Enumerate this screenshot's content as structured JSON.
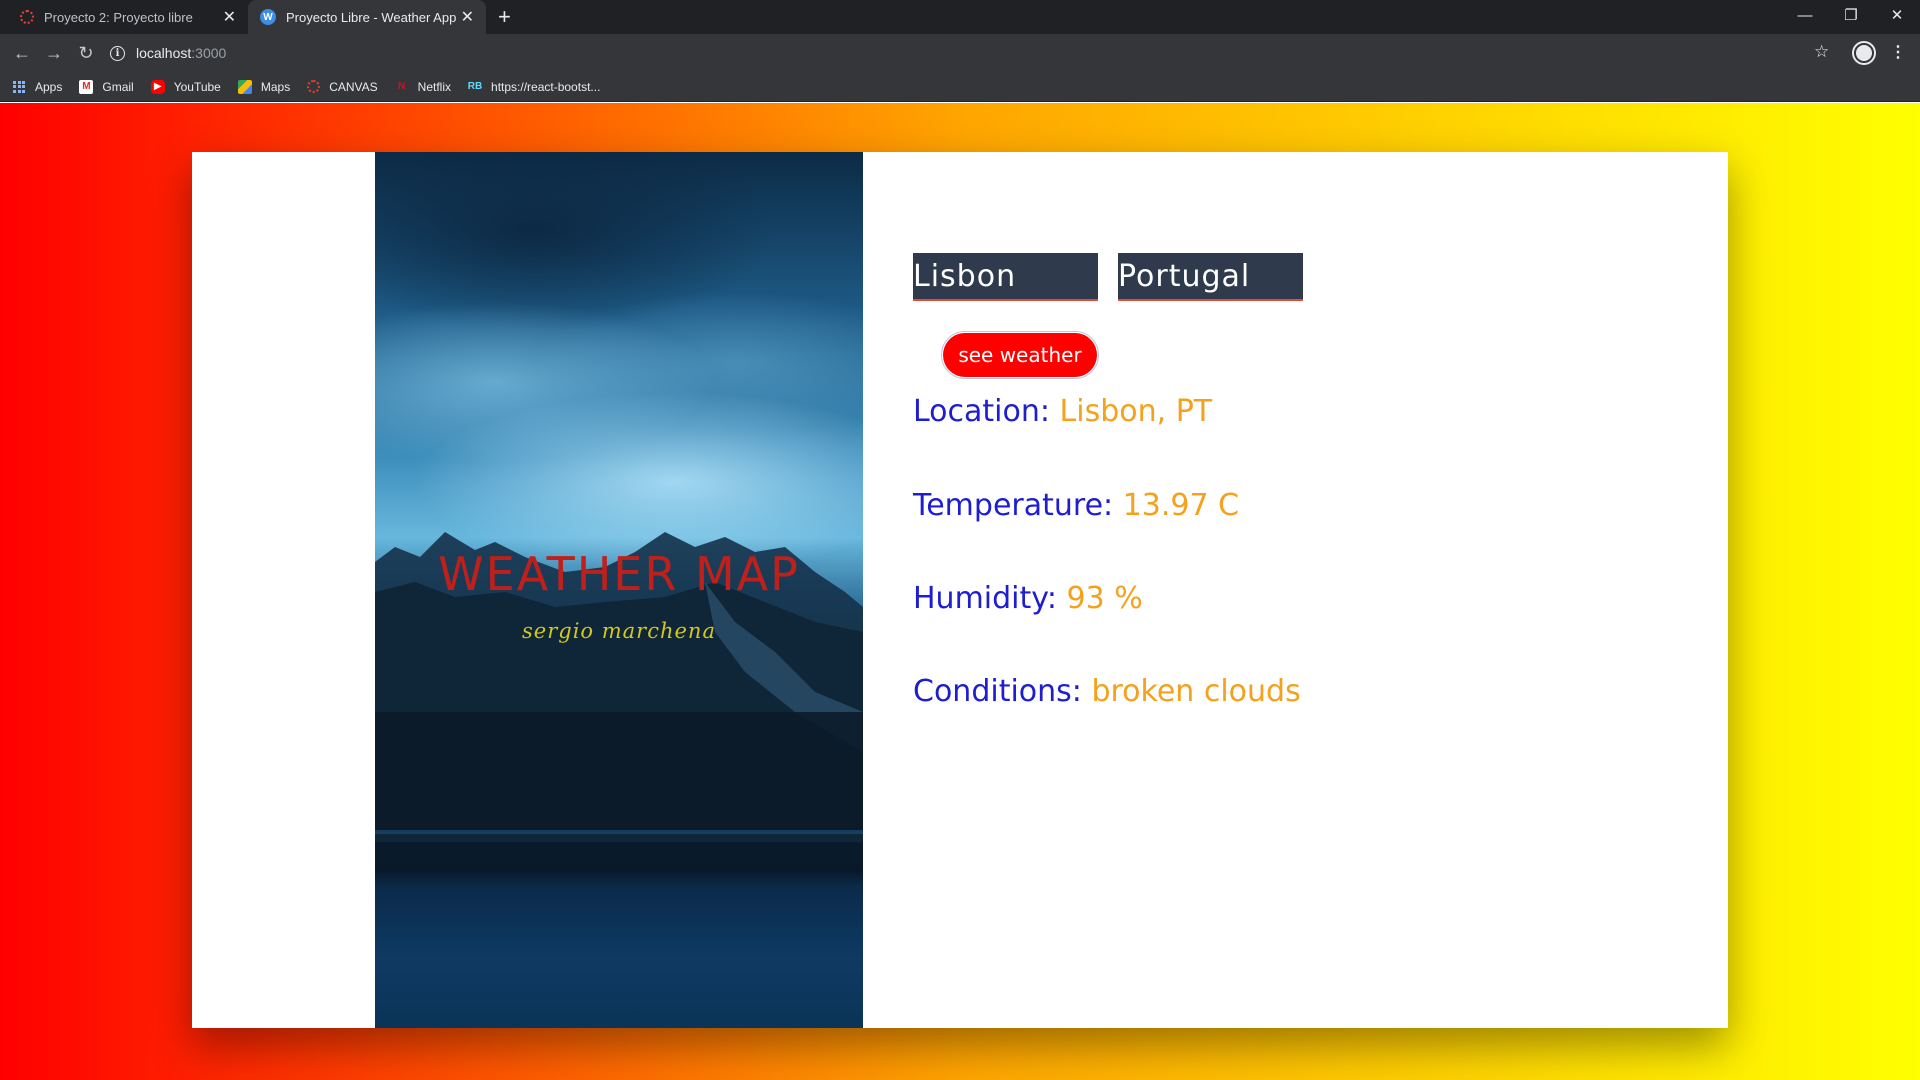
{
  "browser": {
    "tabs": [
      {
        "title": "Proyecto 2: Proyecto libre",
        "icon": "canvas-ring-icon",
        "active": false
      },
      {
        "title": "Proyecto Libre - Weather App",
        "icon": "weather-app-favicon-icon",
        "active": true
      }
    ],
    "address": {
      "host": "localhost",
      "port": ":3000"
    },
    "bookmarks": [
      {
        "label": "Apps",
        "icon": "apps-grid-icon"
      },
      {
        "label": "Gmail",
        "icon": "gmail-icon"
      },
      {
        "label": "YouTube",
        "icon": "youtube-icon"
      },
      {
        "label": "Maps",
        "icon": "maps-icon"
      },
      {
        "label": "CANVAS",
        "icon": "canvas-icon"
      },
      {
        "label": "Netflix",
        "icon": "netflix-icon"
      },
      {
        "label": "https://react-bootst...",
        "icon": "react-bootstrap-icon"
      }
    ]
  },
  "page": {
    "background_gradient": [
      "#ff0000",
      "#ffa500",
      "#ffff00"
    ],
    "hero": {
      "title": "WEATHER MAP",
      "subtitle": "sergio marchena"
    },
    "form": {
      "city_value": "Lisbon",
      "country_value": "Portugal",
      "submit_label": "see weather"
    },
    "results": {
      "location_label": "Location:",
      "location_value": "Lisbon, PT",
      "temperature_label": "Temperature:",
      "temperature_value": "13.97 C",
      "humidity_label": "Humidity:",
      "humidity_value": "93 %",
      "conditions_label": "Conditions:",
      "conditions_value": "broken clouds"
    },
    "colors": {
      "label": "#1e1ed0",
      "value": "#f4a11c",
      "button": "#ff0000",
      "input_bg": "#2f3a4c"
    }
  }
}
